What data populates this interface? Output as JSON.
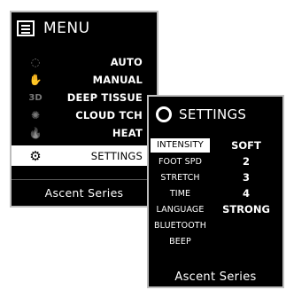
{
  "menu": {
    "title": "MENU",
    "items": [
      {
        "icon": "auto-icon",
        "glyph": "◌",
        "label": "AUTO"
      },
      {
        "icon": "manual-icon",
        "glyph": "✋",
        "label": "MANUAL"
      },
      {
        "icon": "deep-tissue-icon",
        "glyph": "3D",
        "label": "DEEP TISSUE"
      },
      {
        "icon": "cloud-touch-icon",
        "glyph": "✺",
        "label": "CLOUD TCH"
      },
      {
        "icon": "heat-icon",
        "glyph": "🔥",
        "label": "HEAT"
      },
      {
        "icon": "gear-icon",
        "glyph": "⚙",
        "label": "SETTINGS",
        "selected": true
      }
    ],
    "footer": "Ascent Series"
  },
  "settings": {
    "title": "SETTINGS",
    "options": [
      "INTENSITY",
      "FOOT SPD",
      "STRETCH",
      "TIME",
      "LANGUAGE",
      "BLUETOOTH",
      "BEEP"
    ],
    "selected_option": "INTENSITY",
    "values": [
      "SOFT",
      "2",
      "3",
      "4",
      "STRONG",
      "",
      ""
    ],
    "footer": "Ascent Series"
  }
}
